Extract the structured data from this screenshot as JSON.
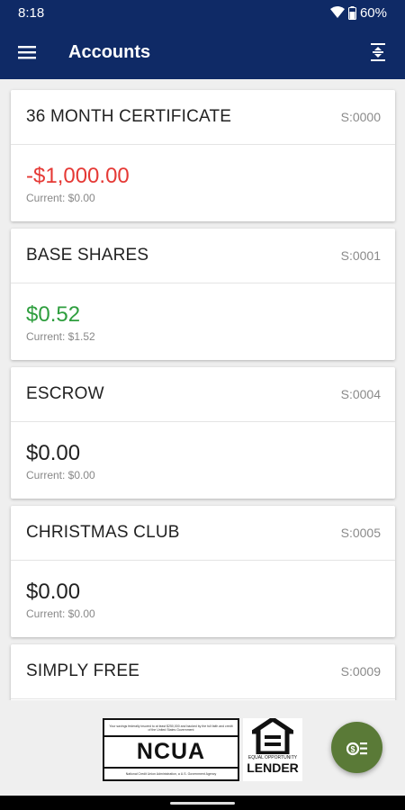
{
  "status": {
    "time": "8:18",
    "battery": "60%"
  },
  "app_bar": {
    "title": "Accounts"
  },
  "accounts": [
    {
      "name": "36 MONTH CERTIFICATE",
      "id": "S:0000",
      "amount": "-$1,000.00",
      "current": "Current: $0.00"
    },
    {
      "name": "BASE SHARES",
      "id": "S:0001",
      "amount": "$0.52",
      "current": "Current: $1.52"
    },
    {
      "name": "ESCROW",
      "id": "S:0004",
      "amount": "$0.00",
      "current": "Current: $0.00"
    },
    {
      "name": "CHRISTMAS CLUB",
      "id": "S:0005",
      "amount": "$0.00",
      "current": "Current: $0.00"
    },
    {
      "name": "SIMPLY FREE",
      "id": "S:0009",
      "amount": "",
      "current": ""
    }
  ],
  "footer": {
    "ncua_fine_top": "Your savings federally insured to at least $250,000 and backed by the full faith and credit of the United States Government",
    "ncua_word": "NCUA",
    "ncua_fine_bottom": "National Credit Union Administration, a U.S. Government Agency",
    "eho_small": "EQUAL OPPORTUNITY",
    "eho_lender": "LENDER"
  },
  "colors": {
    "app_bar": "#0f2a66",
    "negative": "#e53935",
    "positive": "#2e9e3e",
    "fab": "#5a7a37"
  },
  "icons": {
    "menu": "hamburger-menu-icon",
    "expand": "expand-collapse-icon",
    "fab": "transfer-money-icon",
    "wifi": "wifi-icon",
    "battery": "battery-icon"
  }
}
